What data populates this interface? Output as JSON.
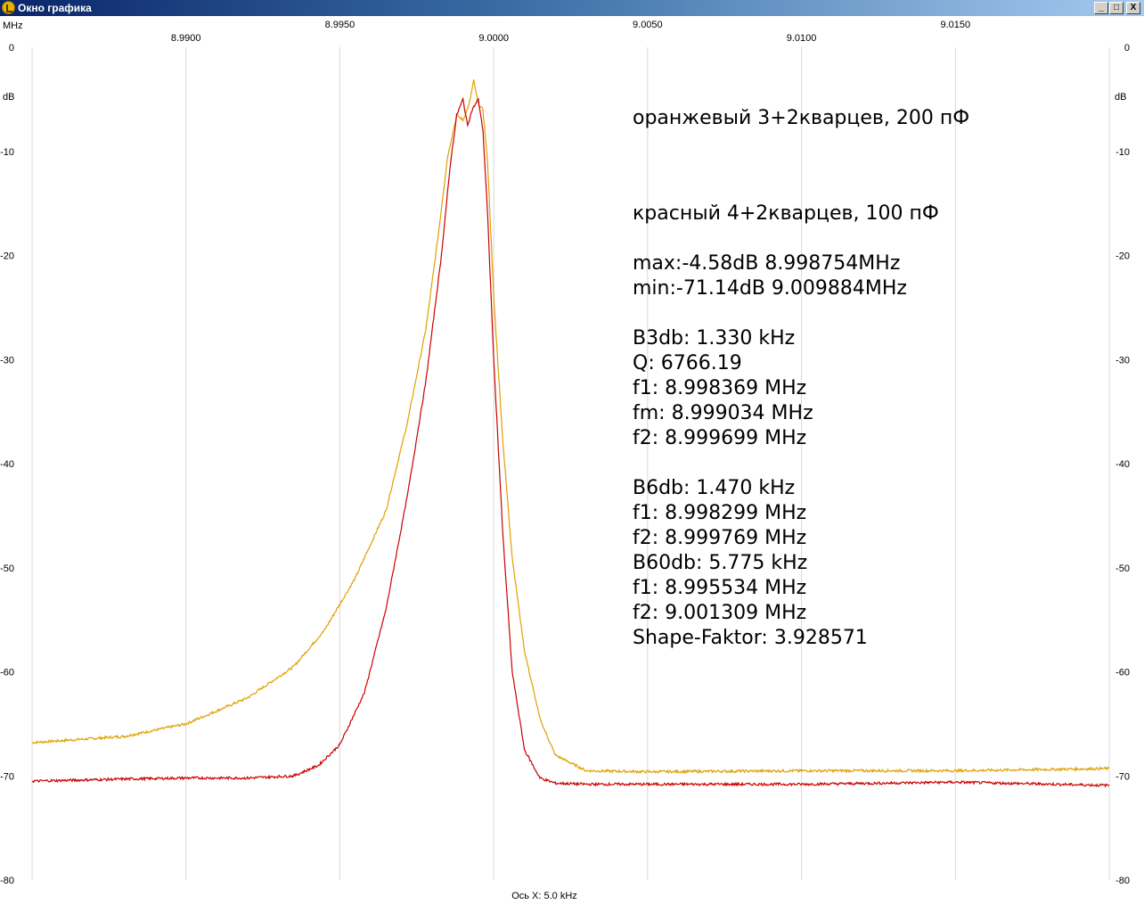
{
  "window": {
    "title": "Окно графика",
    "btn_min": "_",
    "btn_max": "□",
    "btn_close": "X"
  },
  "chart_data": {
    "type": "line",
    "x_unit": "MHz",
    "y_unit": "dB",
    "xlabel": "Ось X: 5.0 kHz",
    "xlim": [
      8.985,
      9.02
    ],
    "ylim": [
      -80,
      0
    ],
    "x_ticks_top": [
      "8.9950",
      "9.0050",
      "9.0150"
    ],
    "x_ticks_bottom": [
      "8.9900",
      "9.0000",
      "9.0100"
    ],
    "x_ticks_top_values": [
      8.995,
      9.005,
      9.015
    ],
    "x_ticks_bottom_values": [
      8.99,
      9.0,
      9.01
    ],
    "y_ticks": [
      "0",
      "-10",
      "-20",
      "-30",
      "-40",
      "-50",
      "-60",
      "-70",
      "-80"
    ],
    "y_tick_values": [
      0,
      -10,
      -20,
      -30,
      -40,
      -50,
      -60,
      -70,
      -80
    ],
    "grid": true,
    "series": [
      {
        "name": "оранжевый 3+2кварцев, 200 пФ",
        "color": "#e0a000",
        "x": [
          8.985,
          8.988,
          8.99,
          8.992,
          8.9935,
          8.9945,
          8.9955,
          8.9965,
          8.9972,
          8.9978,
          8.9982,
          8.9985,
          8.9988,
          8.999,
          8.9992,
          8.99935,
          8.9995,
          8.99965,
          8.9998,
          9.0,
          9.0003,
          9.0006,
          9.001,
          9.0015,
          9.002,
          9.003,
          9.005,
          9.01,
          9.015,
          9.0198
        ],
        "y": [
          -66.8,
          -66.2,
          -65.0,
          -62.5,
          -59.5,
          -56.0,
          -51.0,
          -44.5,
          -36.0,
          -27.0,
          -18.0,
          -10.5,
          -6.5,
          -7.0,
          -5.5,
          -3.2,
          -5.5,
          -6.0,
          -11.0,
          -24.0,
          -38.0,
          -49.0,
          -58.0,
          -64.5,
          -68.0,
          -69.5,
          -69.6,
          -69.5,
          -69.5,
          -69.3
        ]
      },
      {
        "name": "красный 4+2кварцев, 100 пФ",
        "color": "#cc0000",
        "x": [
          8.985,
          8.988,
          8.99,
          8.992,
          8.9935,
          8.9943,
          8.995,
          8.9958,
          8.9965,
          8.9972,
          8.9978,
          8.9983,
          8.9986,
          8.9988,
          8.999,
          8.99915,
          8.9993,
          8.9995,
          8.99965,
          8.9998,
          9.0,
          9.0003,
          9.0006,
          9.001,
          9.0015,
          9.002,
          9.003,
          9.005,
          9.01,
          9.015,
          9.0198
        ],
        "y": [
          -70.5,
          -70.3,
          -70.2,
          -70.2,
          -70.0,
          -69.0,
          -67.0,
          -62.0,
          -54.0,
          -43.0,
          -32.0,
          -20.0,
          -11.0,
          -6.5,
          -5.0,
          -7.5,
          -6.0,
          -5.0,
          -8.0,
          -16.0,
          -30.0,
          -47.0,
          -60.0,
          -67.5,
          -70.2,
          -70.7,
          -70.8,
          -70.8,
          -70.8,
          -70.6,
          -70.9
        ]
      }
    ]
  },
  "annotations": {
    "orange_label": "оранжевый 3+2кварцев, 200 пФ",
    "red_label": "красный 4+2кварцев, 100 пФ",
    "lines": [
      "max:-4.58dB 8.998754MHz",
      "min:-71.14dB 9.009884MHz",
      "",
      "B3db: 1.330 kHz",
      "Q: 6766.19",
      "f1: 8.998369 MHz",
      "fm: 8.999034 MHz",
      "f2: 8.999699 MHz",
      "",
      "B6db: 1.470 kHz",
      "f1: 8.998299 MHz",
      "f2: 8.999769 MHz",
      "B60db: 5.775 kHz",
      "f1: 8.995534 MHz",
      "f2: 9.001309 MHz",
      "Shape-Faktor: 3.928571"
    ]
  }
}
